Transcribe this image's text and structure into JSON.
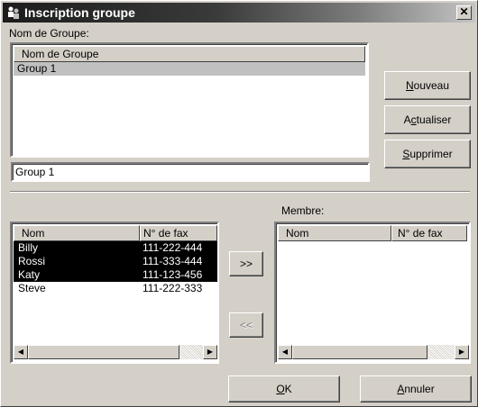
{
  "window": {
    "title": "Inscription groupe",
    "close_glyph": "✕",
    "icon": "group-icon"
  },
  "group_section": {
    "label": "Nom de Groupe:",
    "list_header": "Nom de Groupe",
    "groups": [
      "Group 1"
    ],
    "name_field_value": "Group 1"
  },
  "buttons": {
    "nouveau": {
      "mnemonic": "N",
      "rest": "ouveau"
    },
    "actualiser": {
      "pre": "A",
      "mnemonic": "c",
      "rest": "tualiser"
    },
    "supprimer": {
      "mnemonic": "S",
      "rest": "upprimer"
    },
    "add": ">>",
    "remove": "<<",
    "ok": {
      "mnemonic": "O",
      "rest": "K"
    },
    "annuler": {
      "mnemonic": "A",
      "rest": "nnuler"
    }
  },
  "contacts": {
    "col_name": "Nom",
    "col_fax": "N° de fax",
    "rows": [
      {
        "name": "Billy",
        "fax": "111-222-444",
        "selected": true
      },
      {
        "name": "Rossi",
        "fax": "111-333-444",
        "selected": true
      },
      {
        "name": "Katy",
        "fax": "111-123-456",
        "selected": true
      },
      {
        "name": "Steve",
        "fax": "111-222-333",
        "selected": false
      }
    ]
  },
  "members": {
    "label": "Membre:",
    "col_name": "Nom",
    "col_fax": "N° de fax",
    "rows": []
  },
  "scroll": {
    "left_glyph": "◀",
    "right_glyph": "▶"
  },
  "colors": {
    "selection": "#000000",
    "group_selection": "#c0c0c0",
    "face": "#d4d0c8"
  }
}
